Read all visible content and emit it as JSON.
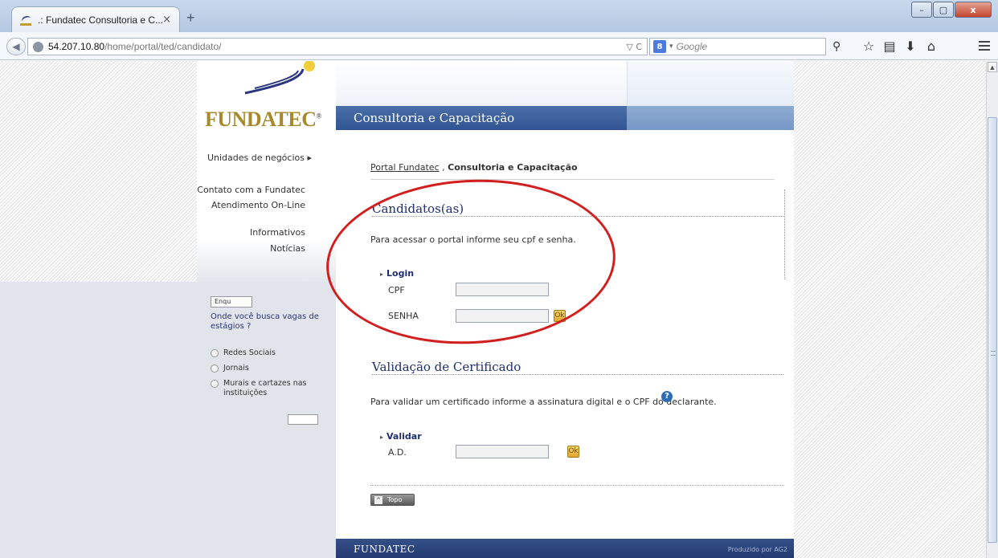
{
  "browser": {
    "tab_title": ".: Fundatec Consultoria e C...",
    "tab_close": "×",
    "new_tab": "+",
    "window_buttons": {
      "minimize": "–",
      "maximize": "▢",
      "close": "x"
    },
    "back": "◀",
    "url_host": "54.207.10.80",
    "url_path": "/home/portal/ted/candidato/",
    "url_tools": "▽ C",
    "search_engine": "8",
    "search_dropdown": "▾",
    "search_placeholder": "Google",
    "search_icon": "⚲",
    "icons": {
      "bookmark": "☆",
      "reader": "▤",
      "download": "⬇",
      "home": "⌂"
    }
  },
  "logo": {
    "text": "FUNDATEC",
    "mark": "®"
  },
  "left_nav": {
    "units": "Unidades de negócios  ▸",
    "contact": "Contato com a Fundatec",
    "online": "Atendimento On-Line",
    "info": "Informativos",
    "news": "Notícias"
  },
  "poll": {
    "button": "Enqu",
    "question": "Onde você busca vagas de estágios ?",
    "options": [
      "Redes Sociais",
      "Jornais",
      "Murais e cartazes nas instituições"
    ],
    "vote_button": ""
  },
  "banner": {
    "title": "Consultoria e Capacitação"
  },
  "breadcrumb": {
    "link": "Portal Fundatec",
    "sep": " , ",
    "current": "Consultoria e Capacitação"
  },
  "candidates": {
    "title": "Candidatos(as)",
    "intro": "Para acessar o portal informe seu cpf e senha.",
    "login_head": "Login",
    "cpf_label": "CPF",
    "cpf_value": "",
    "password_label": "SENHA",
    "password_value": "",
    "ok": "Ok"
  },
  "certificate": {
    "title": "Validação de Certificado",
    "intro": "Para validar um certificado informe a assinatura digital e o CPF do declarante.",
    "help": "?",
    "validate_head": "Validar",
    "ad_label": "A.D.",
    "ad_value": "",
    "ok": "Ok"
  },
  "top_button": {
    "arrow": "^",
    "label": "Topo"
  },
  "footer": {
    "brand": "FUNDATEC",
    "credit": "Produzido por AG2"
  },
  "colors": {
    "accent_blue": "#2f5491",
    "logo_gold": "#a58a2d",
    "annotation_red": "#d11f1f"
  }
}
